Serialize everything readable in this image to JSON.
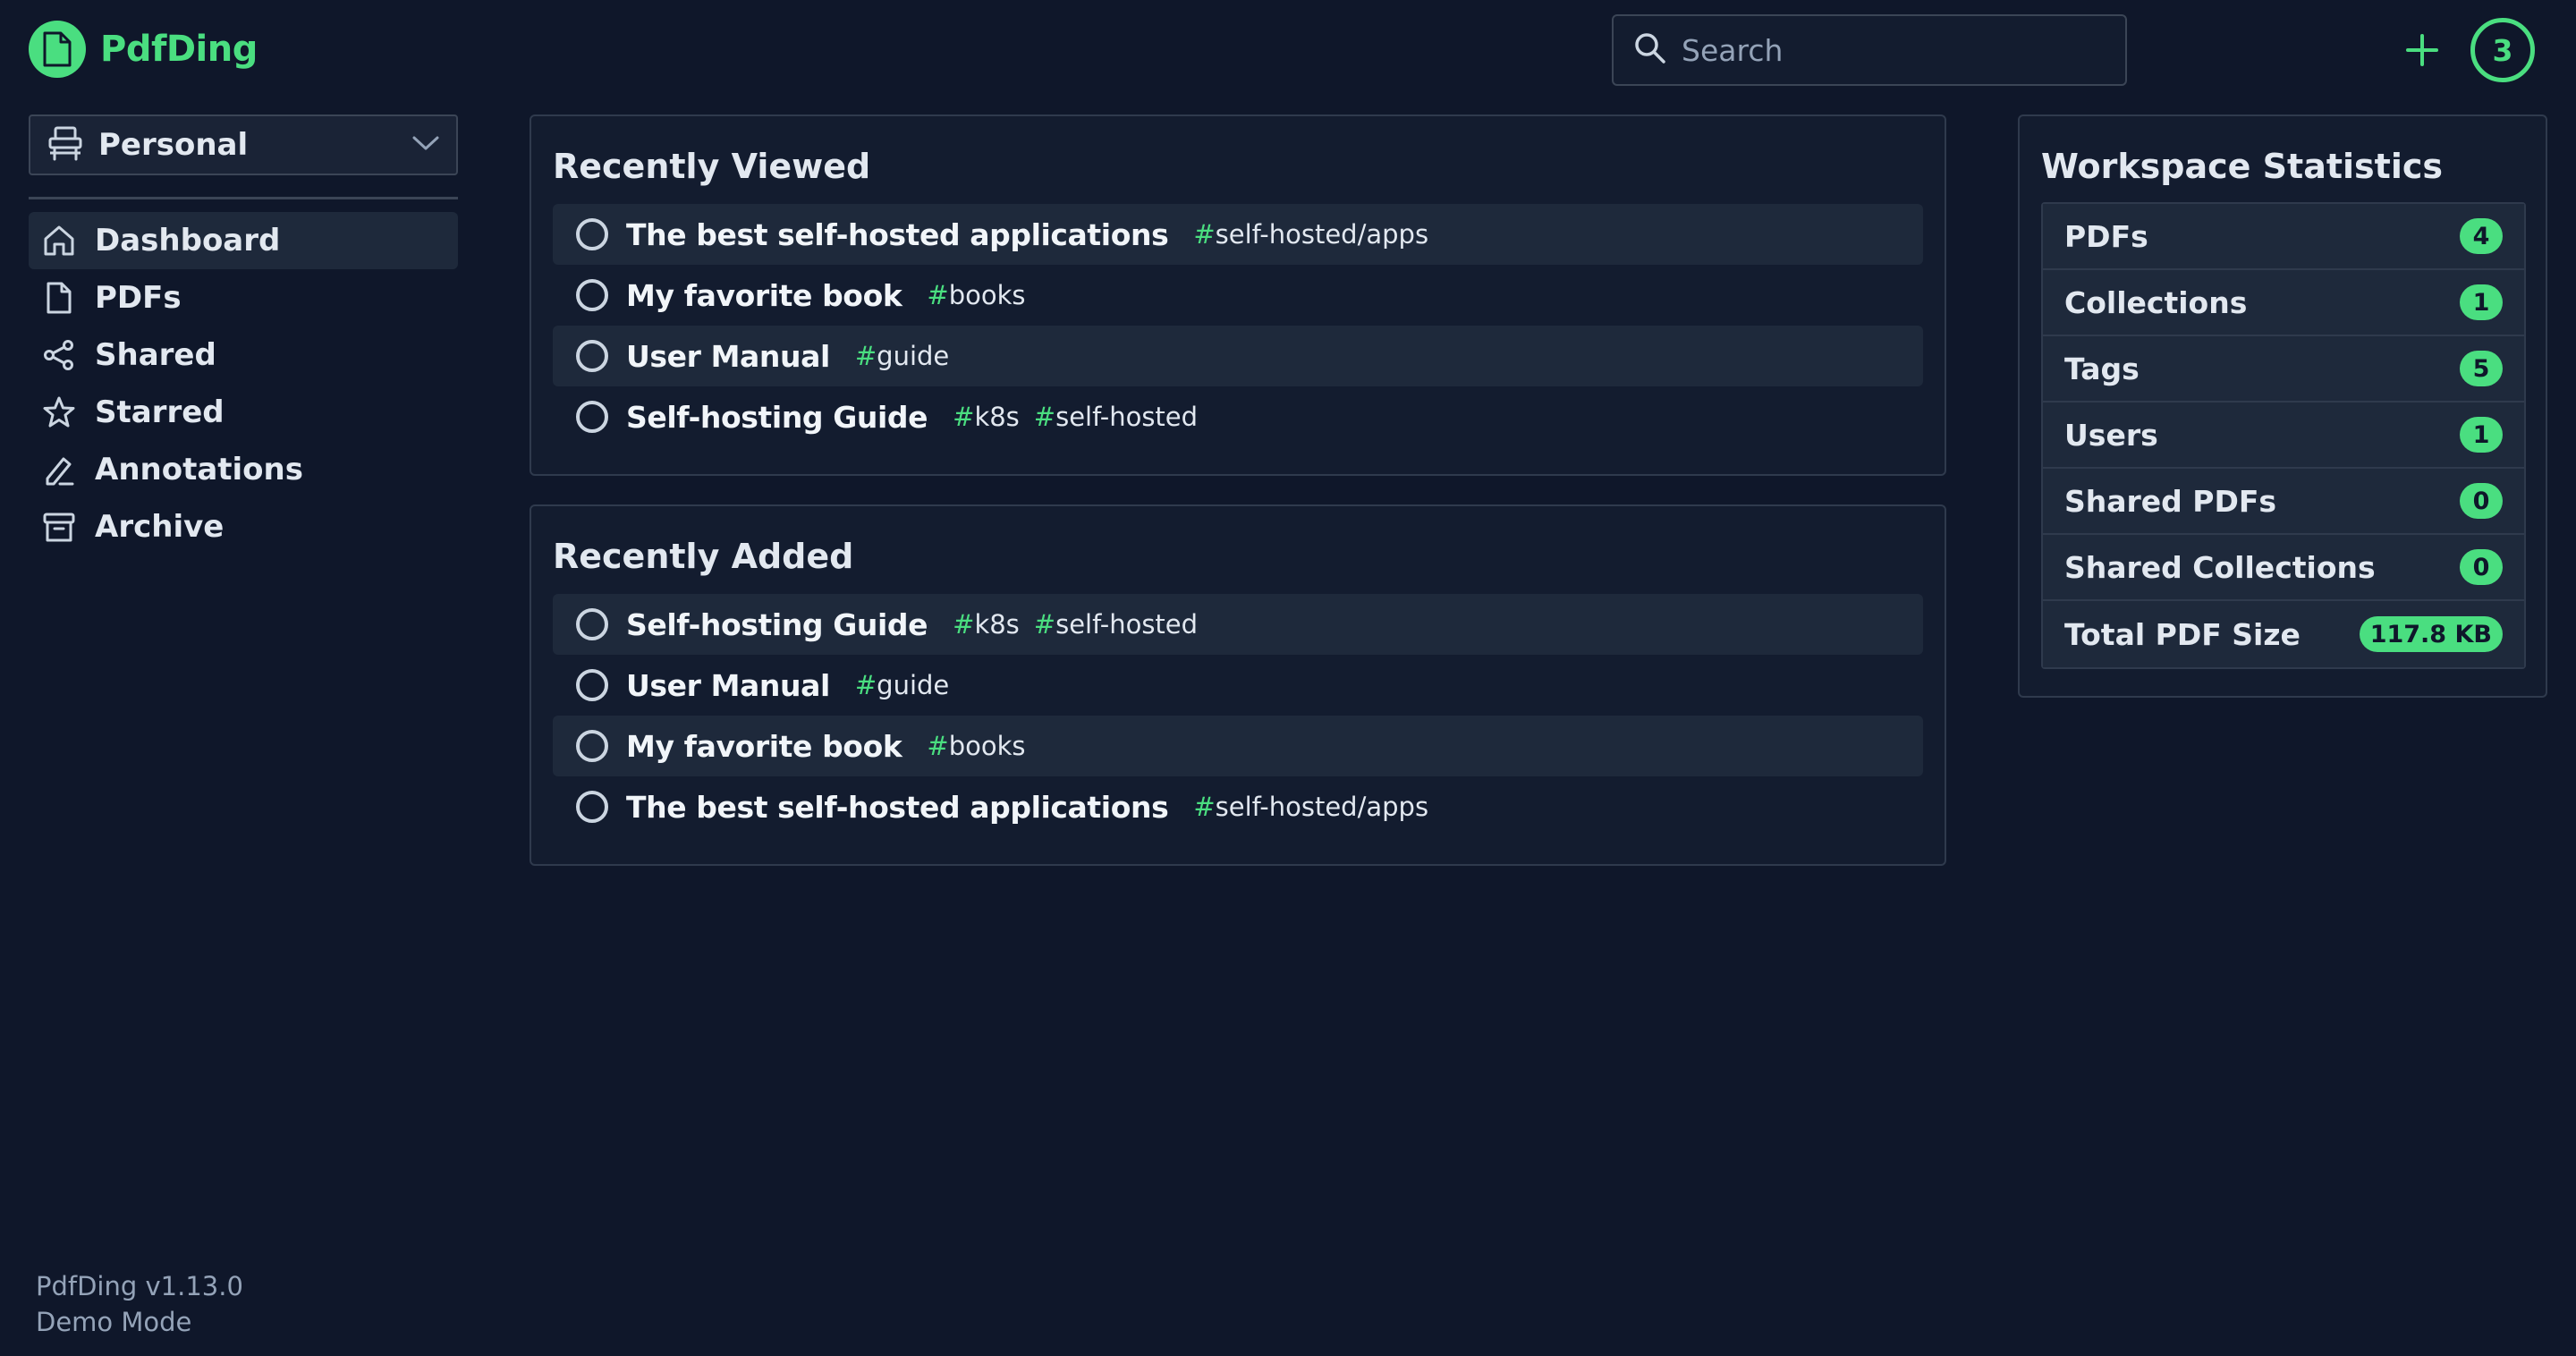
{
  "app": {
    "name": "PdfDing",
    "logo_icon": "file-icon"
  },
  "header": {
    "search_placeholder": "Search",
    "add_icon": "plus-icon",
    "notification_count": "3"
  },
  "sidebar": {
    "workspace": "Personal",
    "items": [
      {
        "label": "Dashboard",
        "icon": "home-icon",
        "active": true
      },
      {
        "label": "PDFs",
        "icon": "file-icon"
      },
      {
        "label": "Shared",
        "icon": "share-icon"
      },
      {
        "label": "Starred",
        "icon": "star-icon"
      },
      {
        "label": "Annotations",
        "icon": "pen-icon"
      },
      {
        "label": "Archive",
        "icon": "archive-icon"
      }
    ],
    "footer": {
      "version": "PdfDing v1.13.0",
      "mode": "Demo Mode"
    }
  },
  "recently_viewed": {
    "title": "Recently Viewed",
    "items": [
      {
        "title": "The best self-hosted applications",
        "tags": [
          "self-hosted/apps"
        ]
      },
      {
        "title": "My favorite book",
        "tags": [
          "books"
        ]
      },
      {
        "title": "User Manual",
        "tags": [
          "guide"
        ]
      },
      {
        "title": "Self-hosting Guide",
        "tags": [
          "k8s",
          "self-hosted"
        ]
      }
    ]
  },
  "recently_added": {
    "title": "Recently Added",
    "items": [
      {
        "title": "Self-hosting Guide",
        "tags": [
          "k8s",
          "self-hosted"
        ]
      },
      {
        "title": "User Manual",
        "tags": [
          "guide"
        ]
      },
      {
        "title": "My favorite book",
        "tags": [
          "books"
        ]
      },
      {
        "title": "The best self-hosted applications",
        "tags": [
          "self-hosted/apps"
        ]
      }
    ]
  },
  "stats": {
    "title": "Workspace Statistics",
    "rows": [
      {
        "label": "PDFs",
        "value": "4"
      },
      {
        "label": "Collections",
        "value": "1"
      },
      {
        "label": "Tags",
        "value": "5"
      },
      {
        "label": "Users",
        "value": "1"
      },
      {
        "label": "Shared PDFs",
        "value": "0"
      },
      {
        "label": "Shared Collections",
        "value": "0"
      },
      {
        "label": "Total PDF Size",
        "value": "117.8 KB"
      }
    ]
  },
  "colors": {
    "accent": "#4ade80",
    "background": "#0f172a",
    "card": "#131c2f",
    "row_stripe": "#1e293b"
  }
}
